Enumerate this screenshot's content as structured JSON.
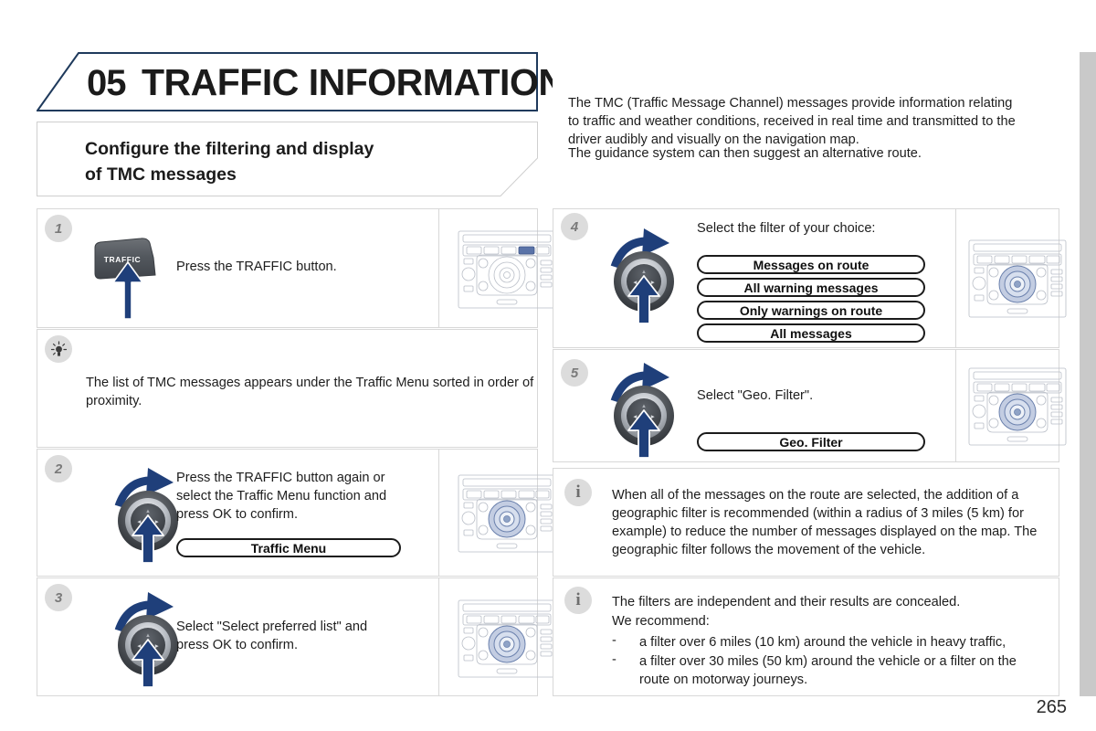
{
  "page": {
    "number": "265",
    "chapter_number": "05",
    "chapter_title": "TRAFFIC INFORMATION",
    "section_title_line1": "Configure the filtering and display",
    "section_title_line2": "of TMC messages"
  },
  "intro": {
    "paragraph1": "The TMC (Traffic Message Channel) messages provide information relating to traffic and weather conditions, received in real time and transmitted to the driver audibly and visually on the navigation map.",
    "paragraph2": "The guidance system can then suggest an alternative route."
  },
  "steps": {
    "s1": {
      "badge": "1",
      "text": "Press the TRAFFIC button.",
      "button_label": "TRAFFIC"
    },
    "tip1": {
      "text": "The list of TMC messages appears under the Traffic Menu sorted in order of proximity."
    },
    "s2": {
      "badge": "2",
      "text": "Press the TRAFFIC button again or select the Traffic Menu function and press OK to confirm.",
      "menu_item": "Traffic Menu"
    },
    "s3": {
      "badge": "3",
      "text": "Select \"Select preferred list\" and press OK to confirm."
    },
    "s4": {
      "badge": "4",
      "text": "Select the filter of your choice:",
      "options": [
        "Messages on route",
        "All warning messages",
        "Only warnings on route",
        "All messages"
      ]
    },
    "s5": {
      "badge": "5",
      "text": "Select \"Geo. Filter\".",
      "menu_item": "Geo. Filter"
    },
    "info1": {
      "badge": "i",
      "text": "When all of the messages on the route are selected, the addition of a geographic filter is recommended (within a radius of 3 miles (5 km) for example) to reduce the number of messages displayed on the map. The geographic filter follows the movement of the vehicle."
    },
    "info2": {
      "badge": "i",
      "line1": "The filters are independent and their results are concealed.",
      "line2": "We recommend:",
      "bullet_marker": "-",
      "bullets": [
        "a filter over 6 miles (10 km) around the vehicle in heavy traffic,",
        "a filter over 30 miles (50 km) around the vehicle or a filter on the route on motorway journeys."
      ]
    }
  },
  "colors": {
    "banner_border": "#1f3a5c",
    "arrow_blue": "#1f3f7a",
    "highlight_blue": "#4a6fa8",
    "badge_gray": "#dcdcdc",
    "card_border": "#d8d8d8",
    "edge_strip": "#c9c9c9"
  }
}
